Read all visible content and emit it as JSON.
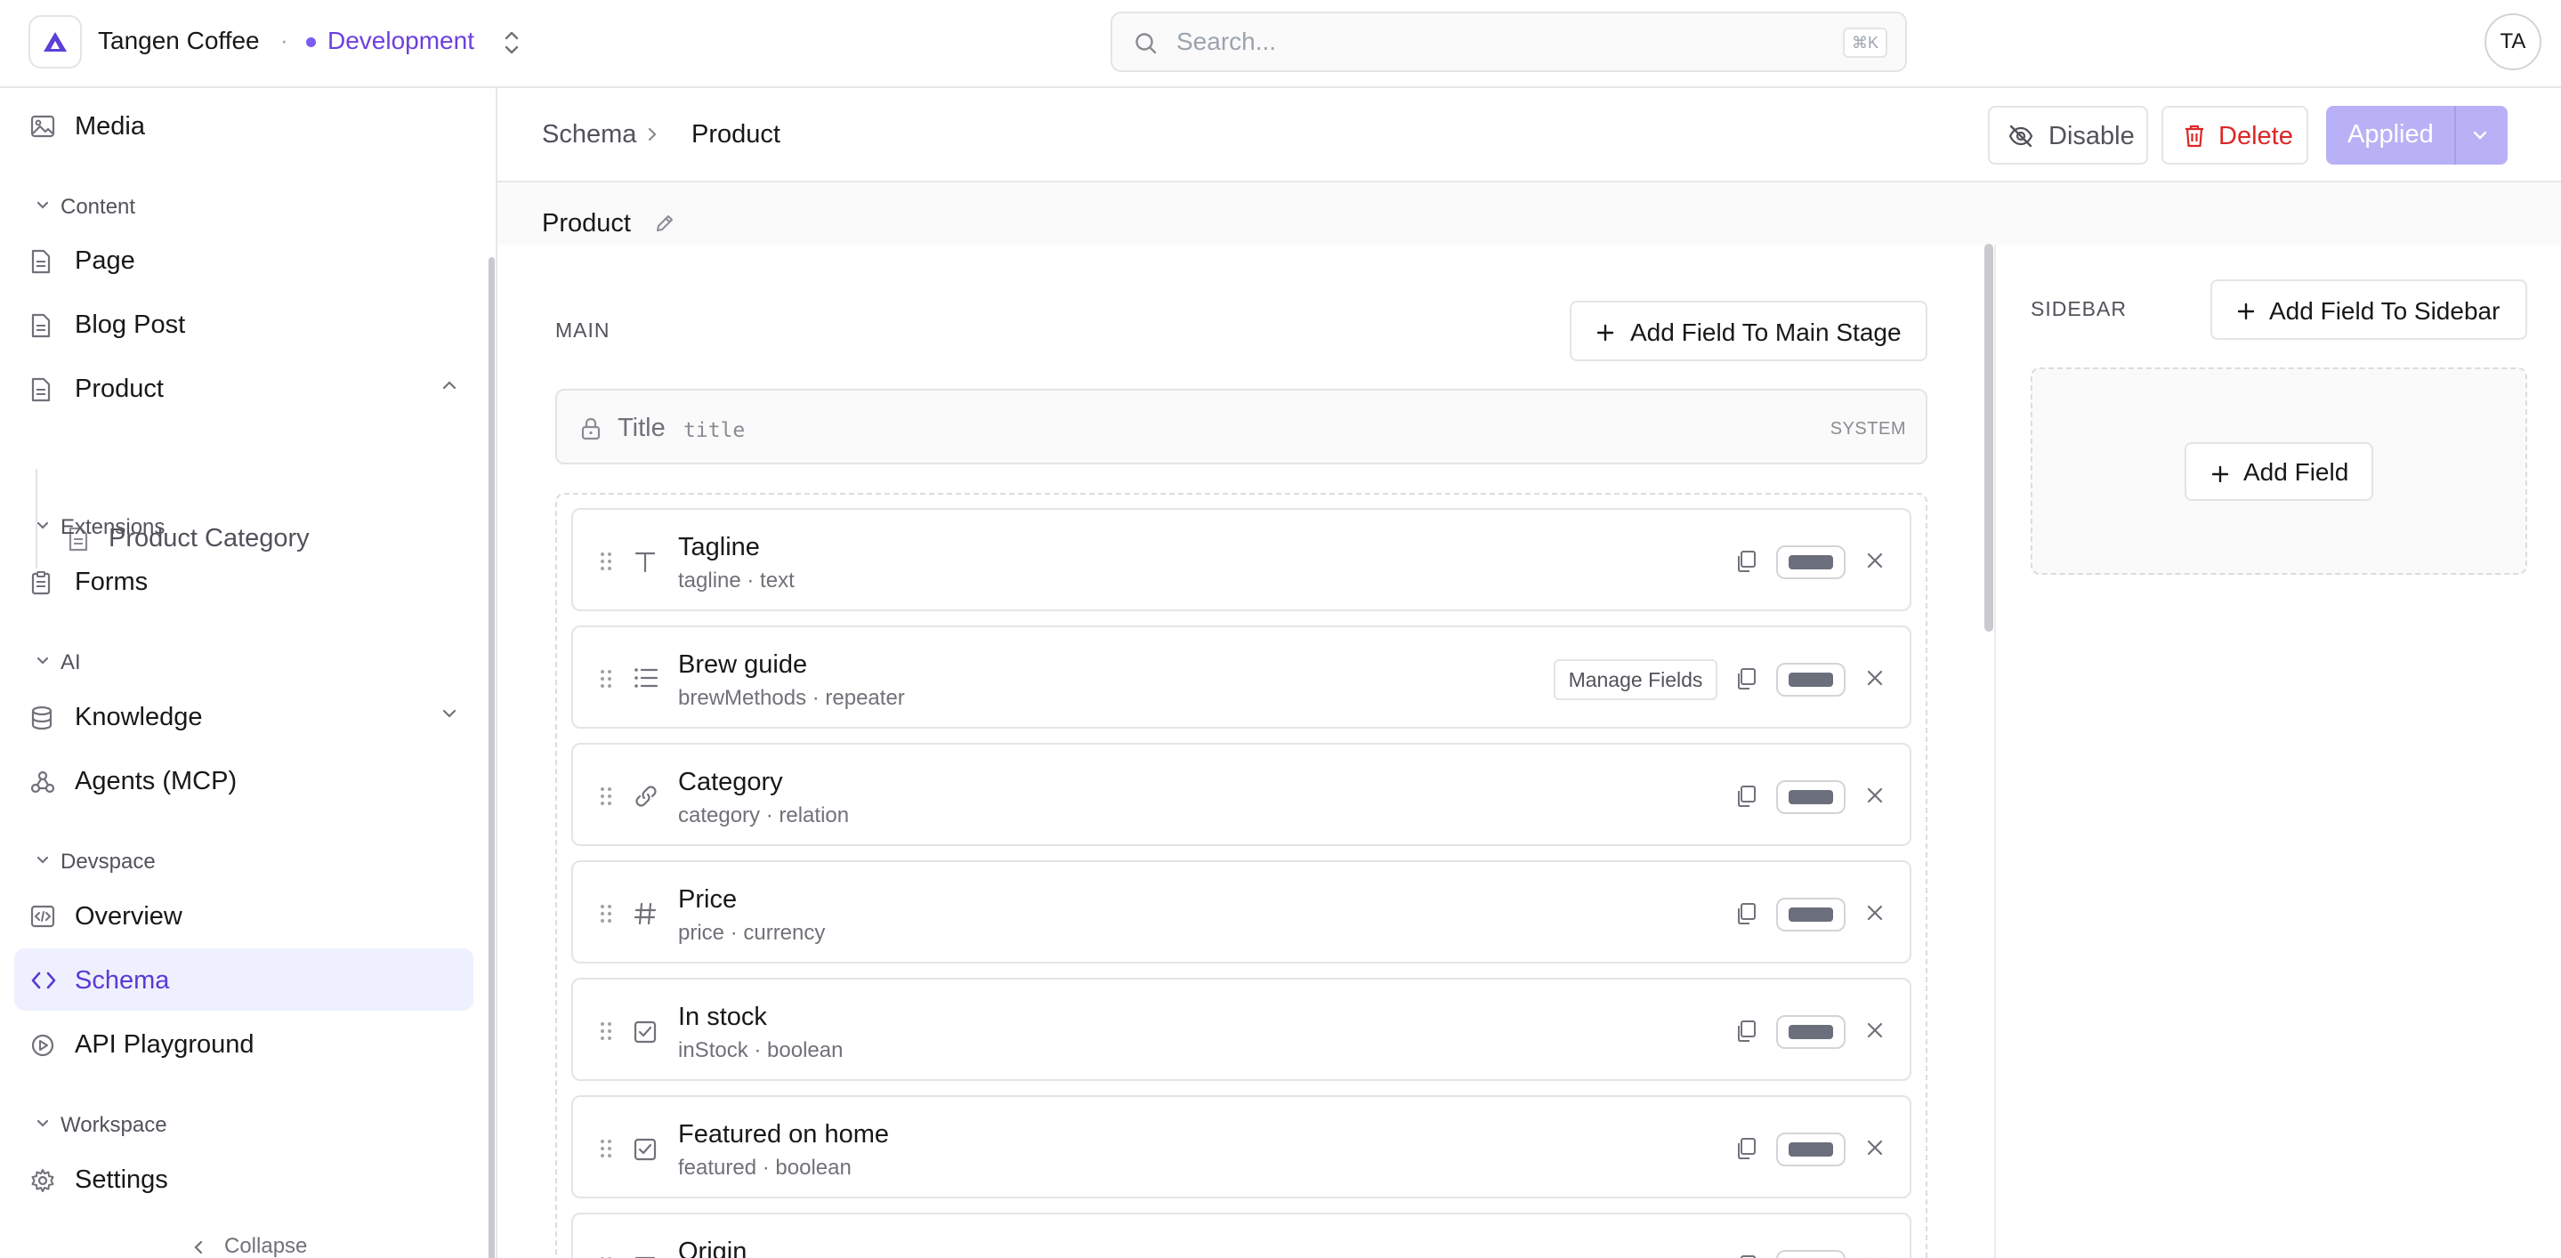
{
  "header": {
    "org_name": "Tangen Coffee",
    "separator": "·",
    "environment": "Development",
    "search_placeholder": "Search...",
    "search_shortcut": "⌘K",
    "user_initials": "TA"
  },
  "sidebar": {
    "top_item": "Media",
    "sections": {
      "content": "Content",
      "extensions": "Extensions",
      "ai": "AI",
      "devspace": "Devspace",
      "workspace": "Workspace"
    },
    "items": {
      "page": "Page",
      "blog_post": "Blog Post",
      "product": "Product",
      "product_category": "Product Category",
      "forms": "Forms",
      "knowledge": "Knowledge",
      "agents": "Agents (MCP)",
      "overview": "Overview",
      "schema": "Schema",
      "api_playground": "API Playground",
      "settings": "Settings"
    },
    "active_item": "Schema",
    "collapse_label": "Collapse"
  },
  "main": {
    "breadcrumb": {
      "root": "Schema",
      "current": "Product"
    },
    "actions": {
      "disable": "Disable",
      "delete": "Delete",
      "applied": "Applied"
    },
    "schema_name": "Product"
  },
  "stage": {
    "main_label": "MAIN",
    "add_main_button": "Add Field To Main Stage",
    "title_field": {
      "name": "Title",
      "key": "title",
      "badge": "SYSTEM"
    },
    "fields": [
      {
        "name": "Tagline",
        "meta": "tagline · text",
        "icon": "text-type-icon"
      },
      {
        "name": "Brew guide",
        "meta": "brewMethods · repeater",
        "icon": "list-icon",
        "manage_label": "Manage Fields"
      },
      {
        "name": "Category",
        "meta": "category · relation",
        "icon": "link-icon"
      },
      {
        "name": "Price",
        "meta": "price · currency",
        "icon": "hash-icon"
      },
      {
        "name": "In stock",
        "meta": "inStock · boolean",
        "icon": "checkbox-icon"
      },
      {
        "name": "Featured on home",
        "meta": "featured · boolean",
        "icon": "checkbox-icon"
      },
      {
        "name": "Origin",
        "meta": "",
        "icon": "text-type-icon"
      }
    ],
    "sidebar_label": "SIDEBAR",
    "add_sidebar_button": "Add Field To Sidebar",
    "add_field_button": "Add Field"
  },
  "colors": {
    "accent": "#6d3fe0",
    "active_bg": "#eef0fd",
    "danger": "#dc2626",
    "applied_bg": "#b9b1f5"
  }
}
